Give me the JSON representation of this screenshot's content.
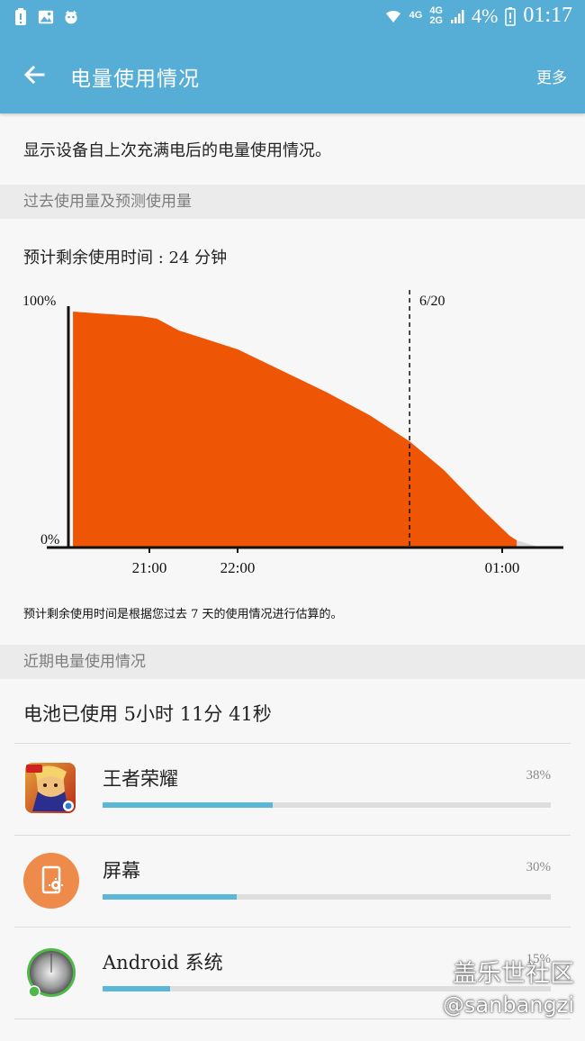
{
  "status_bar": {
    "network_1": "4G",
    "network_2a": "4G",
    "network_2b": "2G",
    "battery_percent": "4%",
    "time": "01:17"
  },
  "app_bar": {
    "title": "电量使用情况",
    "more": "更多",
    "back_icon": "arrow-left-icon"
  },
  "description": "显示设备自上次充满电后的电量使用情况。",
  "section_past": "过去使用量及预测使用量",
  "estimate_text": "预计剩余使用时间 : 24 分钟",
  "chart_data": {
    "type": "area",
    "y_axis_labels": [
      "100%",
      "0%"
    ],
    "x_tick_labels": [
      "21:00",
      "22:00",
      "01:00"
    ],
    "marker_label": "6/20",
    "fill_color": "#ee5504",
    "series": [
      {
        "x": [
          "20:08",
          "20:30",
          "20:55",
          "21:05",
          "21:20",
          "21:40",
          "22:00",
          "22:30",
          "23:00",
          "23:30",
          "23:57",
          "00:20",
          "00:45",
          "01:05",
          "01:10"
        ],
        "values": [
          100,
          99,
          98,
          97,
          92,
          88,
          84,
          75,
          66,
          56,
          45,
          33,
          17,
          5,
          3
        ]
      }
    ],
    "projection": {
      "x": [
        "01:10",
        "01:26"
      ],
      "values": [
        3,
        0
      ]
    }
  },
  "footnote": "预计剩余使用时间是根据您过去 7 天的使用情况进行估算的。",
  "section_recent": "近期电量使用情况",
  "battery_used": "电池已使用 5小时 11分 41秒",
  "apps": [
    {
      "name": "王者荣耀",
      "percent_label": "38%",
      "percent": 38,
      "icon": "honor-of-kings-icon"
    },
    {
      "name": "屏幕",
      "percent_label": "30%",
      "percent": 30,
      "icon": "screen-icon"
    },
    {
      "name": "Android 系统",
      "percent_label": "15%",
      "percent": 15,
      "icon": "android-system-icon"
    }
  ],
  "watermark": {
    "line1": "盖乐世社区",
    "line2": "@sanbangzi"
  },
  "colors": {
    "app_bar": "#56aed6",
    "chart_fill": "#ee5504",
    "usage_bar": "#5bb7d8"
  }
}
